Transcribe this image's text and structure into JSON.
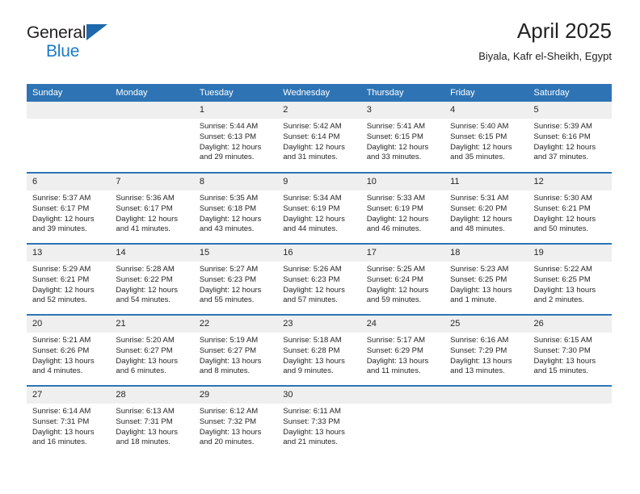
{
  "brand": {
    "name_part1": "General",
    "name_part2": "Blue",
    "logo_icon": "triangle-logo-icon"
  },
  "header": {
    "title": "April 2025",
    "location": "Biyala, Kafr el-Sheikh, Egypt"
  },
  "colors": {
    "header_blue": "#2e74b5",
    "brand_blue": "#1b7ac7",
    "daynum_band": "#efefef",
    "text": "#262626"
  },
  "weekday_headers": [
    "Sunday",
    "Monday",
    "Tuesday",
    "Wednesday",
    "Thursday",
    "Friday",
    "Saturday"
  ],
  "labels": {
    "sunrise": "Sunrise:",
    "sunset": "Sunset:",
    "daylight": "Daylight:"
  },
  "weeks": [
    [
      {
        "day": "",
        "empty": true
      },
      {
        "day": "",
        "empty": true
      },
      {
        "day": "1",
        "sunrise": "Sunrise: 5:44 AM",
        "sunset": "Sunset: 6:13 PM",
        "daylight_line1": "Daylight: 12 hours",
        "daylight_line2": "and 29 minutes."
      },
      {
        "day": "2",
        "sunrise": "Sunrise: 5:42 AM",
        "sunset": "Sunset: 6:14 PM",
        "daylight_line1": "Daylight: 12 hours",
        "daylight_line2": "and 31 minutes."
      },
      {
        "day": "3",
        "sunrise": "Sunrise: 5:41 AM",
        "sunset": "Sunset: 6:15 PM",
        "daylight_line1": "Daylight: 12 hours",
        "daylight_line2": "and 33 minutes."
      },
      {
        "day": "4",
        "sunrise": "Sunrise: 5:40 AM",
        "sunset": "Sunset: 6:15 PM",
        "daylight_line1": "Daylight: 12 hours",
        "daylight_line2": "and 35 minutes."
      },
      {
        "day": "5",
        "sunrise": "Sunrise: 5:39 AM",
        "sunset": "Sunset: 6:16 PM",
        "daylight_line1": "Daylight: 12 hours",
        "daylight_line2": "and 37 minutes."
      }
    ],
    [
      {
        "day": "6",
        "sunrise": "Sunrise: 5:37 AM",
        "sunset": "Sunset: 6:17 PM",
        "daylight_line1": "Daylight: 12 hours",
        "daylight_line2": "and 39 minutes."
      },
      {
        "day": "7",
        "sunrise": "Sunrise: 5:36 AM",
        "sunset": "Sunset: 6:17 PM",
        "daylight_line1": "Daylight: 12 hours",
        "daylight_line2": "and 41 minutes."
      },
      {
        "day": "8",
        "sunrise": "Sunrise: 5:35 AM",
        "sunset": "Sunset: 6:18 PM",
        "daylight_line1": "Daylight: 12 hours",
        "daylight_line2": "and 43 minutes."
      },
      {
        "day": "9",
        "sunrise": "Sunrise: 5:34 AM",
        "sunset": "Sunset: 6:19 PM",
        "daylight_line1": "Daylight: 12 hours",
        "daylight_line2": "and 44 minutes."
      },
      {
        "day": "10",
        "sunrise": "Sunrise: 5:33 AM",
        "sunset": "Sunset: 6:19 PM",
        "daylight_line1": "Daylight: 12 hours",
        "daylight_line2": "and 46 minutes."
      },
      {
        "day": "11",
        "sunrise": "Sunrise: 5:31 AM",
        "sunset": "Sunset: 6:20 PM",
        "daylight_line1": "Daylight: 12 hours",
        "daylight_line2": "and 48 minutes."
      },
      {
        "day": "12",
        "sunrise": "Sunrise: 5:30 AM",
        "sunset": "Sunset: 6:21 PM",
        "daylight_line1": "Daylight: 12 hours",
        "daylight_line2": "and 50 minutes."
      }
    ],
    [
      {
        "day": "13",
        "sunrise": "Sunrise: 5:29 AM",
        "sunset": "Sunset: 6:21 PM",
        "daylight_line1": "Daylight: 12 hours",
        "daylight_line2": "and 52 minutes."
      },
      {
        "day": "14",
        "sunrise": "Sunrise: 5:28 AM",
        "sunset": "Sunset: 6:22 PM",
        "daylight_line1": "Daylight: 12 hours",
        "daylight_line2": "and 54 minutes."
      },
      {
        "day": "15",
        "sunrise": "Sunrise: 5:27 AM",
        "sunset": "Sunset: 6:23 PM",
        "daylight_line1": "Daylight: 12 hours",
        "daylight_line2": "and 55 minutes."
      },
      {
        "day": "16",
        "sunrise": "Sunrise: 5:26 AM",
        "sunset": "Sunset: 6:23 PM",
        "daylight_line1": "Daylight: 12 hours",
        "daylight_line2": "and 57 minutes."
      },
      {
        "day": "17",
        "sunrise": "Sunrise: 5:25 AM",
        "sunset": "Sunset: 6:24 PM",
        "daylight_line1": "Daylight: 12 hours",
        "daylight_line2": "and 59 minutes."
      },
      {
        "day": "18",
        "sunrise": "Sunrise: 5:23 AM",
        "sunset": "Sunset: 6:25 PM",
        "daylight_line1": "Daylight: 13 hours",
        "daylight_line2": "and 1 minute."
      },
      {
        "day": "19",
        "sunrise": "Sunrise: 5:22 AM",
        "sunset": "Sunset: 6:25 PM",
        "daylight_line1": "Daylight: 13 hours",
        "daylight_line2": "and 2 minutes."
      }
    ],
    [
      {
        "day": "20",
        "sunrise": "Sunrise: 5:21 AM",
        "sunset": "Sunset: 6:26 PM",
        "daylight_line1": "Daylight: 13 hours",
        "daylight_line2": "and 4 minutes."
      },
      {
        "day": "21",
        "sunrise": "Sunrise: 5:20 AM",
        "sunset": "Sunset: 6:27 PM",
        "daylight_line1": "Daylight: 13 hours",
        "daylight_line2": "and 6 minutes."
      },
      {
        "day": "22",
        "sunrise": "Sunrise: 5:19 AM",
        "sunset": "Sunset: 6:27 PM",
        "daylight_line1": "Daylight: 13 hours",
        "daylight_line2": "and 8 minutes."
      },
      {
        "day": "23",
        "sunrise": "Sunrise: 5:18 AM",
        "sunset": "Sunset: 6:28 PM",
        "daylight_line1": "Daylight: 13 hours",
        "daylight_line2": "and 9 minutes."
      },
      {
        "day": "24",
        "sunrise": "Sunrise: 5:17 AM",
        "sunset": "Sunset: 6:29 PM",
        "daylight_line1": "Daylight: 13 hours",
        "daylight_line2": "and 11 minutes."
      },
      {
        "day": "25",
        "sunrise": "Sunrise: 6:16 AM",
        "sunset": "Sunset: 7:29 PM",
        "daylight_line1": "Daylight: 13 hours",
        "daylight_line2": "and 13 minutes."
      },
      {
        "day": "26",
        "sunrise": "Sunrise: 6:15 AM",
        "sunset": "Sunset: 7:30 PM",
        "daylight_line1": "Daylight: 13 hours",
        "daylight_line2": "and 15 minutes."
      }
    ],
    [
      {
        "day": "27",
        "sunrise": "Sunrise: 6:14 AM",
        "sunset": "Sunset: 7:31 PM",
        "daylight_line1": "Daylight: 13 hours",
        "daylight_line2": "and 16 minutes."
      },
      {
        "day": "28",
        "sunrise": "Sunrise: 6:13 AM",
        "sunset": "Sunset: 7:31 PM",
        "daylight_line1": "Daylight: 13 hours",
        "daylight_line2": "and 18 minutes."
      },
      {
        "day": "29",
        "sunrise": "Sunrise: 6:12 AM",
        "sunset": "Sunset: 7:32 PM",
        "daylight_line1": "Daylight: 13 hours",
        "daylight_line2": "and 20 minutes."
      },
      {
        "day": "30",
        "sunrise": "Sunrise: 6:11 AM",
        "sunset": "Sunset: 7:33 PM",
        "daylight_line1": "Daylight: 13 hours",
        "daylight_line2": "and 21 minutes."
      },
      {
        "day": "",
        "empty": true
      },
      {
        "day": "",
        "empty": true
      },
      {
        "day": "",
        "empty": true
      }
    ]
  ]
}
